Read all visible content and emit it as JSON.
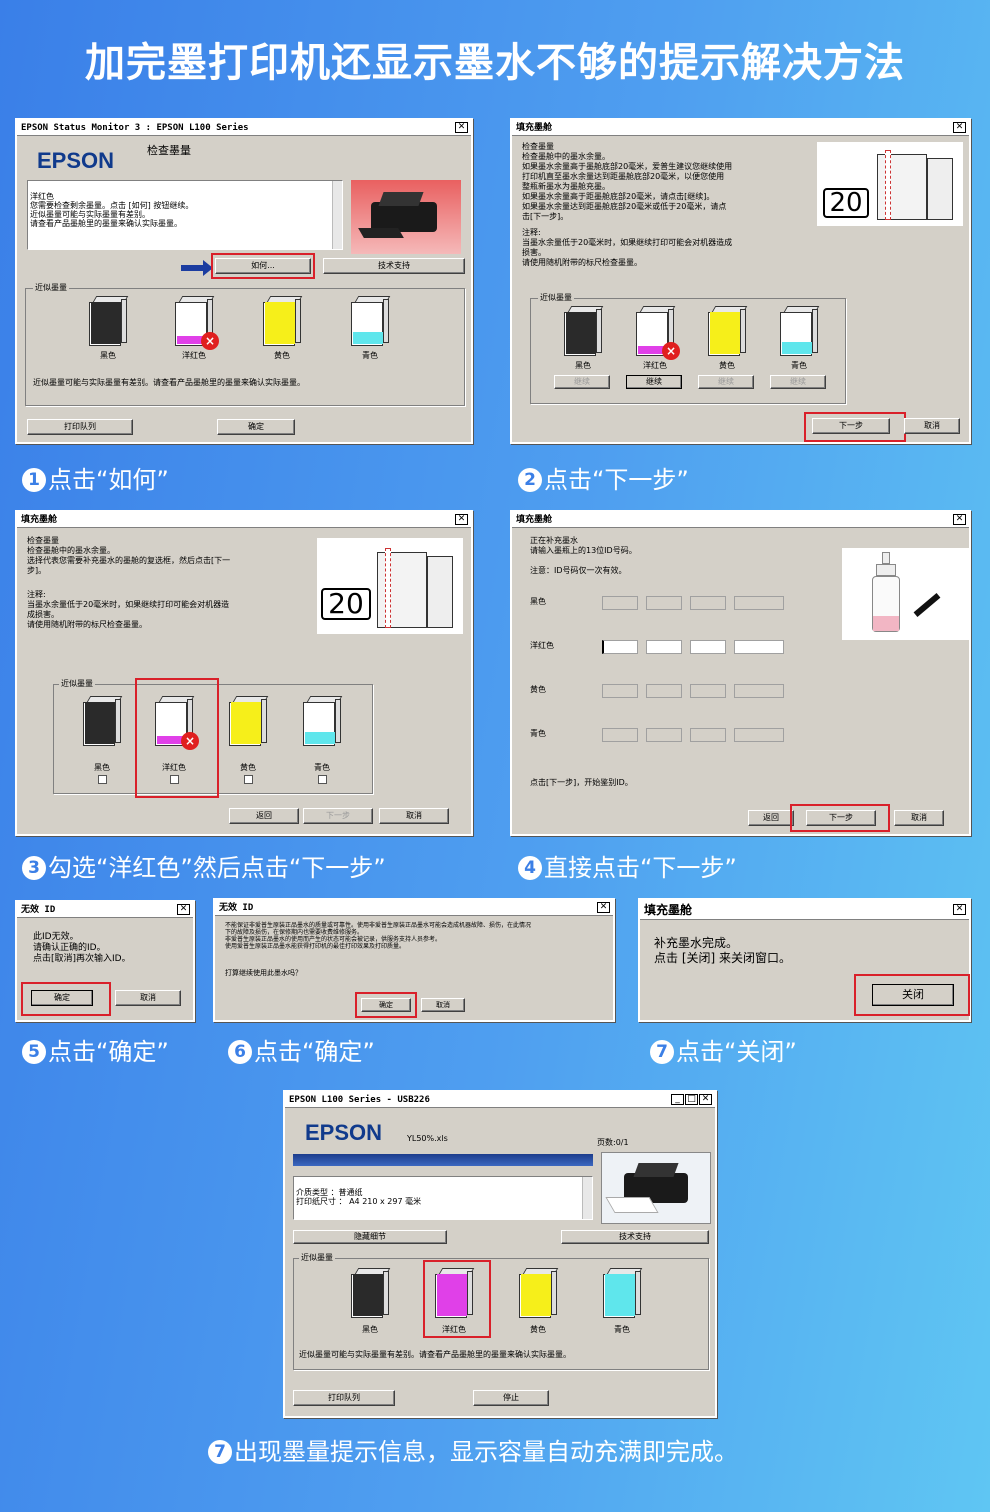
{
  "title": "加完墨打印机还显示墨水不够的提示解决方法",
  "steps": [
    {
      "num": "1",
      "caption": "点击“如何”"
    },
    {
      "num": "2",
      "caption": "点击“下一步”"
    },
    {
      "num": "3",
      "caption": "勾选“洋红色”然后点击“下一步”"
    },
    {
      "num": "4",
      "caption": "直接点击“下一步”"
    },
    {
      "num": "5",
      "caption": "点击“确定”"
    },
    {
      "num": "6",
      "caption": "点击“确定”"
    },
    {
      "num": "7",
      "caption": "点击“关闭”"
    },
    {
      "num": "7",
      "caption": "出现墨量提示信息，显示容量自动充满即完成。"
    }
  ],
  "ink": {
    "black": "黑色",
    "magenta": "洋红色",
    "yellow": "黄色",
    "cyan": "青色",
    "group": "近似墨量"
  },
  "colors": {
    "black": "#2a2a2a",
    "magenta": "#e040e8",
    "yellow": "#f6ef1a",
    "cyan": "#5fe6ec",
    "highlight": "#d9202a"
  },
  "w1": {
    "title": "EPSON Status Monitor 3 : EPSON L100 Series",
    "logo": "EPSON",
    "heading": "检查墨量",
    "message": "洋红色\n您需要检查剩余墨量。点击 [如何] 按钮继续。\n近似墨量可能与实际墨量有差别。\n请查看产品墨舱里的墨量来确认实际墨量。",
    "how_button": "如何...",
    "support_button": "技术支持",
    "note": "近似墨量可能与实际墨量有差别。请查看产品墨舱里的墨量来确认实际墨量。",
    "queue_button": "打印队列",
    "ok_button": "确定"
  },
  "w2": {
    "title": "填充墨舱",
    "text": "检查墨量\n检查墨舱中的墨水余量。\n如果墨水余量高于墨舱底部20毫米，爱普生建议您继续使用\n打印机直至墨水余量达到距墨舱底部20毫米，以便您使用\n整瓶新墨水为墨舱充墨。\n如果墨水余量高于距墨舱底部20毫米，请点击[继续]。\n如果墨水余量达到距墨舱底部20毫米或低于20毫米，请点\n击[下一步]。",
    "note": "注释:\n当墨水余量低于20毫米时，如果继续打印可能会对机器造成\n损害。\n请使用随机附带的标尺检查墨量。",
    "level": "20",
    "continue": "继续",
    "next": "下一步",
    "cancel": "取消"
  },
  "w3": {
    "title": "填充墨舱",
    "text": "检查墨量\n检查墨舱中的墨水余量。\n选择代表您需要补充墨水的墨舱的复选框，然后点击[下一\n步]。",
    "note": "注释:\n当墨水余量低于20毫米时，如果继续打印可能会对机器造\n成损害。\n请使用随机附带的标尺检查墨量。",
    "level": "20",
    "back": "返回",
    "next": "下一步",
    "cancel": "取消"
  },
  "w4": {
    "title": "填充墨舱",
    "text": "正在补充墨水\n请输入墨瓶上的13位ID号码。",
    "note": "注意：ID号码仅一次有效。",
    "footer": "点击[下一步]，开始鉴别ID。",
    "back": "返回",
    "next": "下一步",
    "cancel": "取消"
  },
  "w5": {
    "title": "无效 ID",
    "text": "此ID无效。\n请确认正确的ID。\n点击[取消]再次输入ID。",
    "ok": "确定",
    "cancel": "取消"
  },
  "w6": {
    "title": "无效 ID",
    "text": "不能保证非爱普生原装正品墨水的质量或可靠性。使用非爱普生原装正品墨水可能会造成机器故障、损伤，在此情况\n下的故障及损伤，在保修期内也需要收费维修服务。\n非爱普生原装正品墨水的使用而产生的状态可能会被记录，供服务支持人员参考。\n使用爱普生原装正品墨水能获得打印机的最佳打印效果及打印质量。",
    "question": "打算继续使用此墨水吗？",
    "ok": "确定",
    "cancel": "取消"
  },
  "w7": {
    "title": "填充墨舱",
    "text": "补充墨水完成。\n点击 [关闭] 来关闭窗口。",
    "close": "关闭"
  },
  "w8": {
    "title": "EPSON L100 Series - USB226",
    "logo": "EPSON",
    "document": "YL50%.xls",
    "pages": "页数:0/1",
    "media": "介质类型 ：普通纸\n打印纸尺寸 ： A4 210 x 297 毫米",
    "hide": "隐藏细节",
    "support": "技术支持",
    "note": "近似墨量可能与实际墨量有差别。请查看产品墨舱里的墨量来确认实际墨量。",
    "queue": "打印队列",
    "stop": "停止"
  }
}
